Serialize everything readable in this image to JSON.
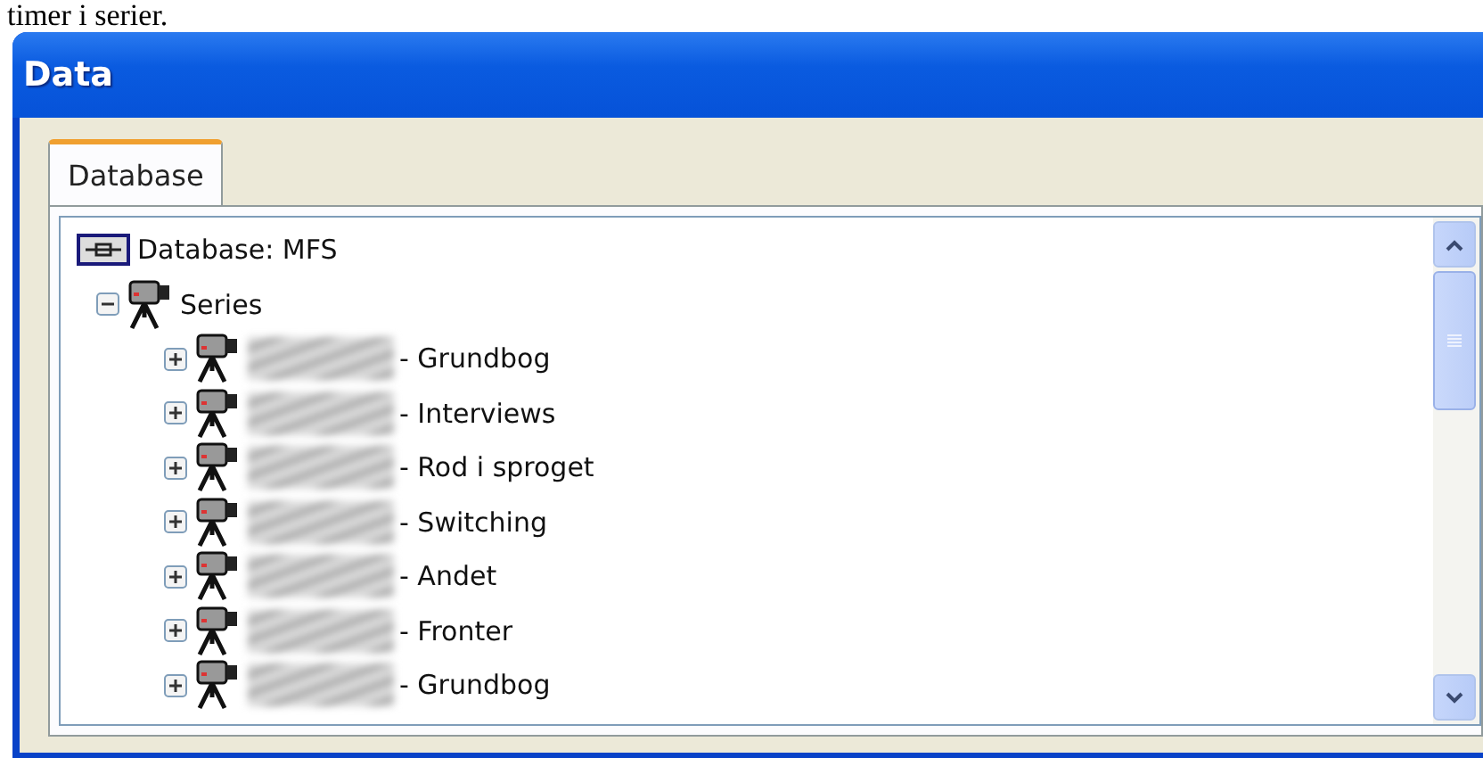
{
  "caption": "timer i serier.",
  "window": {
    "title": "Data"
  },
  "tabs": [
    {
      "label": "Database",
      "selected": true
    }
  ],
  "tree": [
    {
      "label": "Database: MFS",
      "kind": "database",
      "children": [
        {
          "label": "Series",
          "kind": "camera",
          "expanded": true,
          "children": [
            {
              "label": "- Grundbog",
              "kind": "camera",
              "expanded": false,
              "redacted": true
            },
            {
              "label": "- Interviews",
              "kind": "camera",
              "expanded": false,
              "redacted": true
            },
            {
              "label": "- Rod i sproget",
              "kind": "camera",
              "expanded": false,
              "redacted": true
            },
            {
              "label": "- Switching",
              "kind": "camera",
              "expanded": false,
              "redacted": true
            },
            {
              "label": "- Andet",
              "kind": "camera",
              "expanded": false,
              "redacted": true
            },
            {
              "label": "- Fronter",
              "kind": "camera",
              "expanded": false,
              "redacted": true
            },
            {
              "label": "- Grundbog",
              "kind": "camera",
              "expanded": false,
              "redacted": true
            }
          ]
        }
      ]
    }
  ]
}
